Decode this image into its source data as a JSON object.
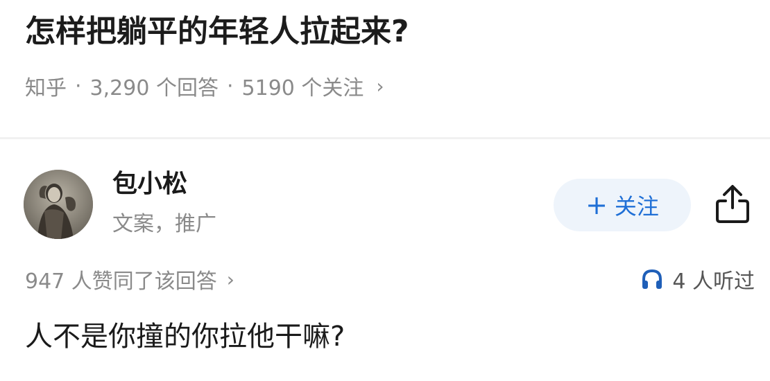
{
  "question": {
    "title": "怎样把躺平的年轻人拉起来?",
    "source": "知乎",
    "separator": "·",
    "answers_count": "3,290 个回答",
    "followers_count": "5190 个关注",
    "chevron": "›"
  },
  "author": {
    "name": "包小松",
    "bio": "文案，推广",
    "avatar_icon": "portrait-avatar"
  },
  "actions": {
    "follow_plus": "+",
    "follow_label": "关注",
    "share_icon": "share-icon",
    "accent_color": "#1f6fd6"
  },
  "stats": {
    "upvotes": "947 人赞同了该回答",
    "upvotes_chevron": "›",
    "listens": "4 人听过",
    "listen_icon": "headphones-icon"
  },
  "answer": {
    "text": "人不是你撞的你拉他干嘛?"
  }
}
